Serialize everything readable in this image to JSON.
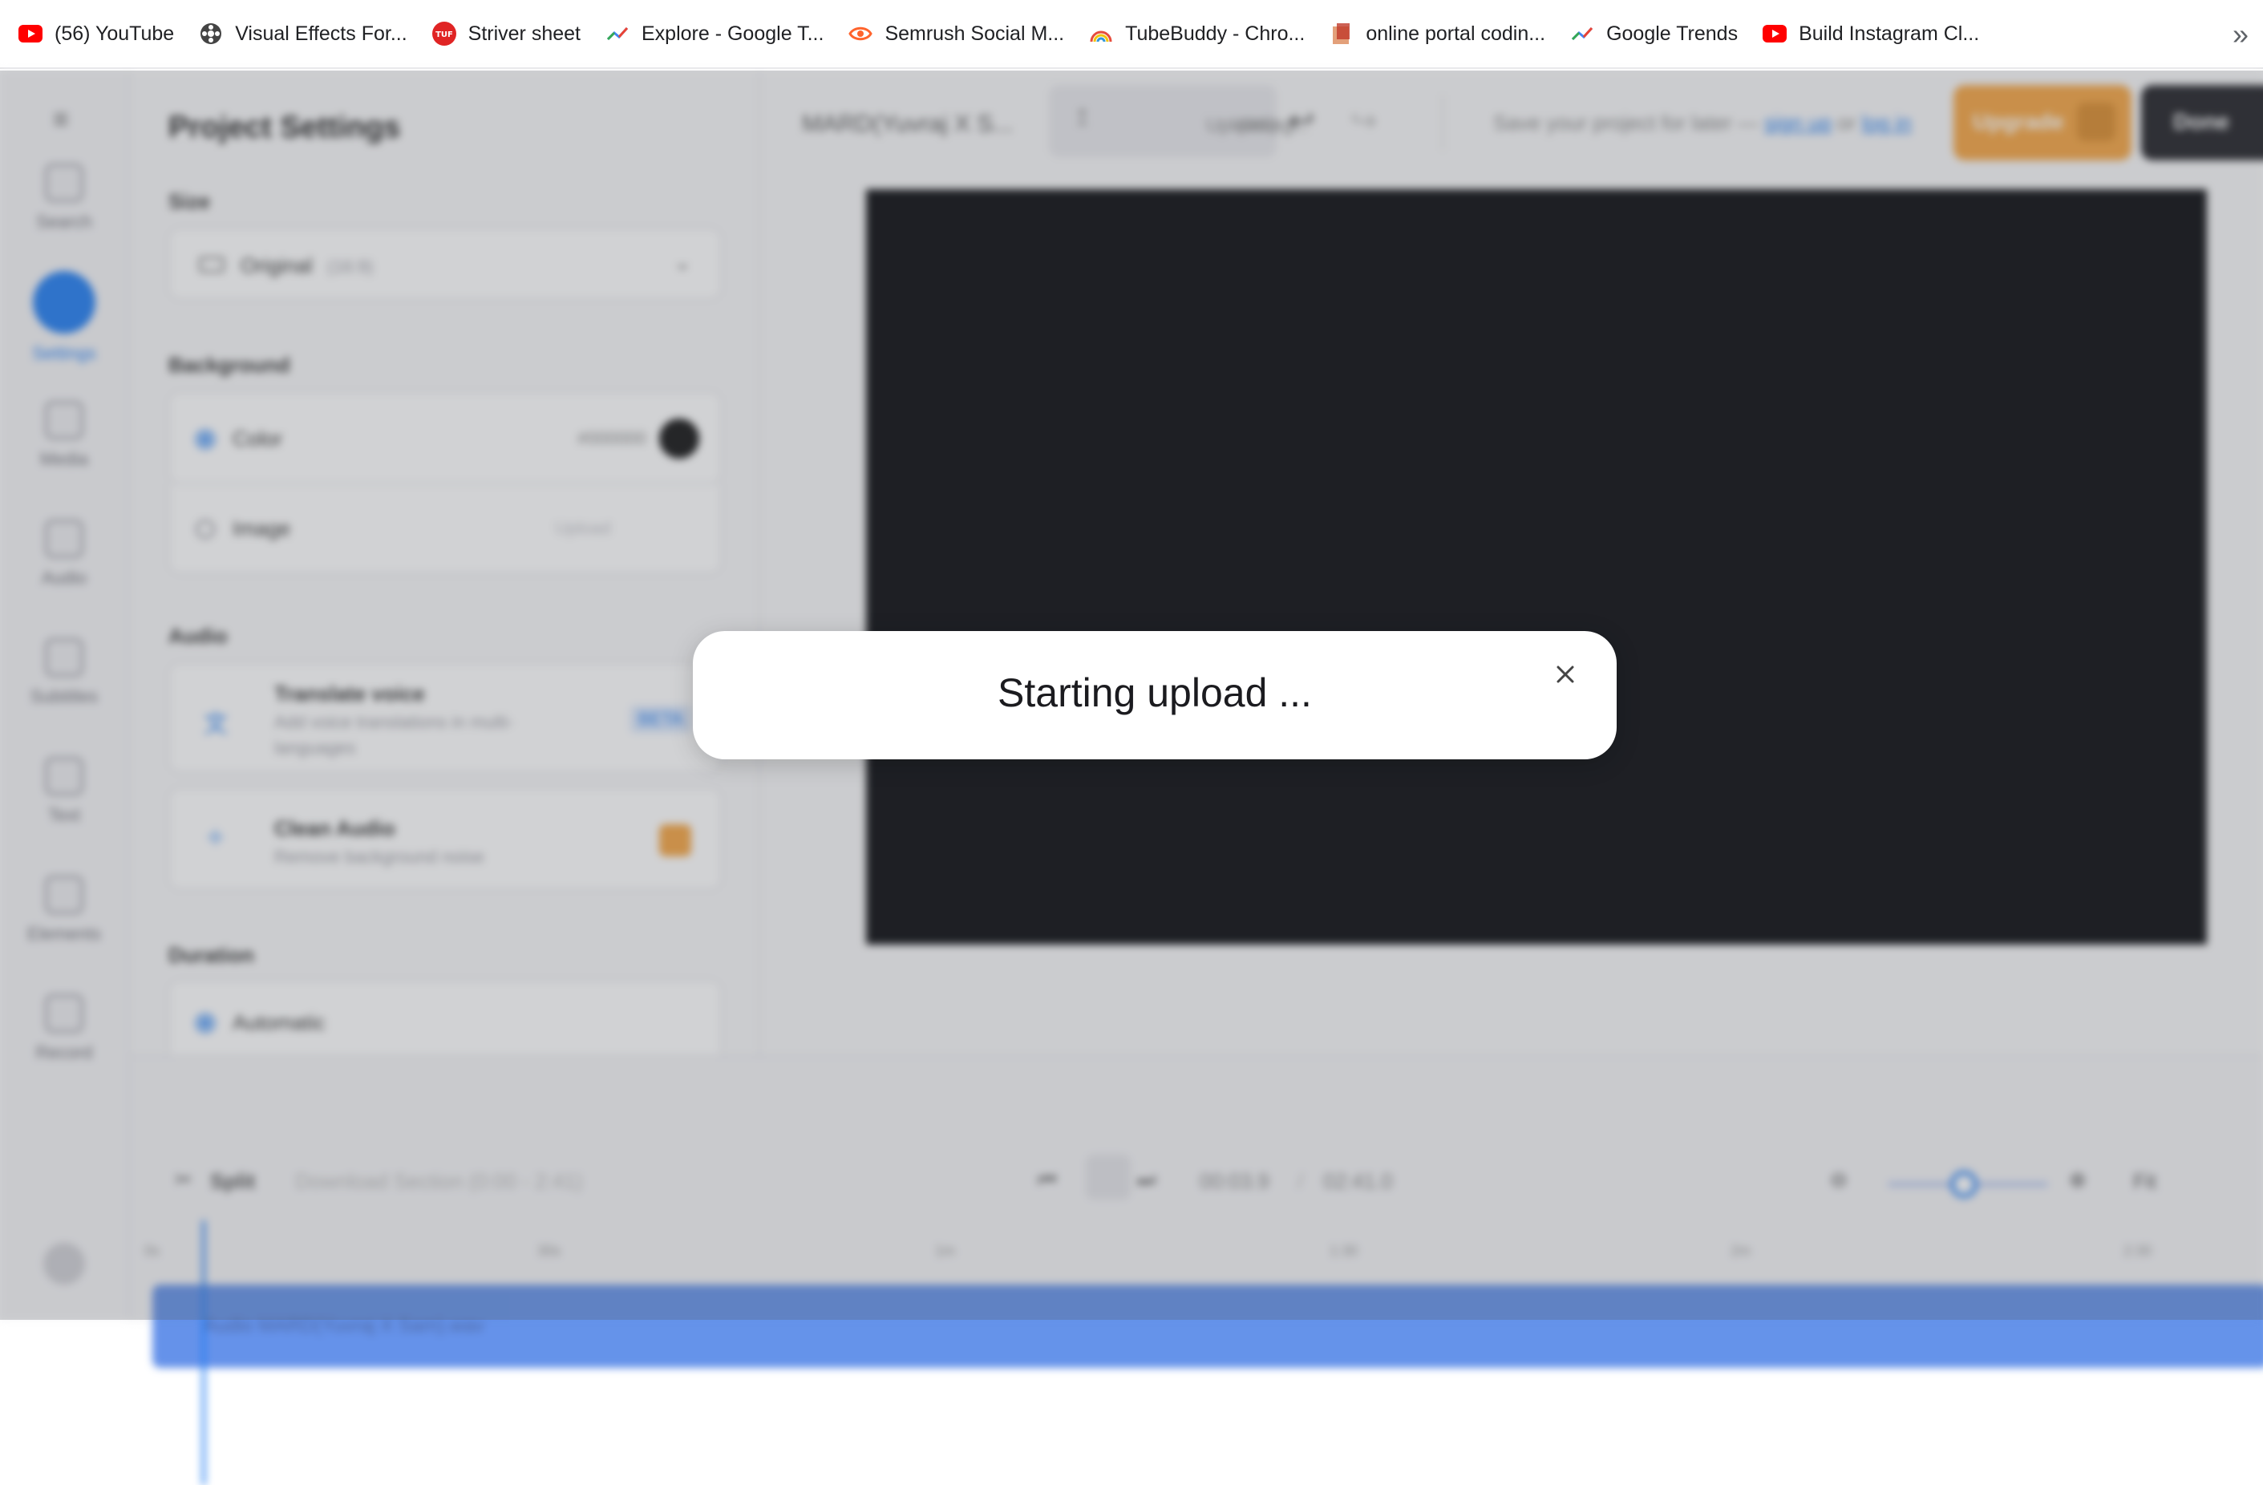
{
  "bookmarks": {
    "items": [
      {
        "label": "(56) YouTube",
        "icon": "youtube-icon"
      },
      {
        "label": "Visual Effects For...",
        "icon": "film-reel-icon"
      },
      {
        "label": "Striver sheet",
        "icon": "tuf-logo-icon"
      },
      {
        "label": "Explore - Google T...",
        "icon": "trends-icon"
      },
      {
        "label": "Semrush Social M...",
        "icon": "semrush-icon"
      },
      {
        "label": "TubeBuddy - Chro...",
        "icon": "rainbow-icon"
      },
      {
        "label": "online portal codin...",
        "icon": "box-icon"
      },
      {
        "label": "Google Trends",
        "icon": "trends-icon"
      },
      {
        "label": "Build Instagram Cl...",
        "icon": "youtube-icon"
      }
    ],
    "more": "»"
  },
  "rail": {
    "items": [
      {
        "label": "Search"
      },
      {
        "label": "Settings"
      },
      {
        "label": "Media"
      },
      {
        "label": "Audio"
      },
      {
        "label": "Subtitles"
      },
      {
        "label": "Text"
      },
      {
        "label": "Elements"
      },
      {
        "label": "Record"
      }
    ]
  },
  "settings": {
    "title": "Project Settings",
    "size_label": "Size",
    "size_value": "Original",
    "size_ratio": "(16:9)",
    "background_label": "Background",
    "color_option": "Color",
    "color_value": "#000000",
    "image_option": "Image",
    "image_action": "Upload",
    "audio_label": "Audio",
    "translate_title": "Translate voice",
    "translate_desc_1": "Add voice translations in multi-",
    "translate_desc_2": "languages",
    "translate_badge": "BETA",
    "clean_title": "Clean Audio",
    "clean_desc": "Remove background noise",
    "duration_label": "Duration",
    "duration_option": "Automatic"
  },
  "topbar": {
    "project_title": "MARD(Yuvraj X S...",
    "uploading_1": "Uploading...",
    "uploading_2": "(0%)",
    "save_text": "Save your project for later — ",
    "sign_up": "sign up",
    "or": " or ",
    "log_in": "log in",
    "upgrade": "Upgrade",
    "done": "Done"
  },
  "timeline": {
    "split": "Split",
    "download": "Download Section (0:00 - 2:41)",
    "current_time": "00:03.9",
    "separator": "/",
    "total_time": "02:41.0",
    "fit": "Fit",
    "ticks": [
      "0s",
      "30s",
      "1m",
      "1:30",
      "2m",
      "2:30"
    ],
    "track_label": "Audio MARD(Yuvraj X Sam).wav"
  },
  "modal": {
    "message": "Starting upload ..."
  },
  "colors": {
    "accent": "#1f7cf2",
    "upgrade": "#f4a340",
    "track": "#3a74e4"
  }
}
